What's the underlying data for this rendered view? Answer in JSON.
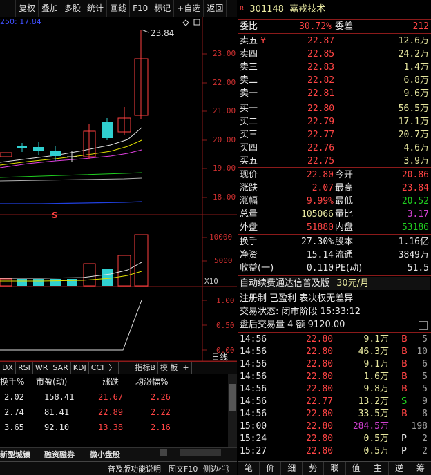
{
  "toolbar": {
    "items": [
      "复权",
      "叠加",
      "多股",
      "统计",
      "画线",
      "F10",
      "标记",
      "+自选",
      "返回"
    ]
  },
  "chart": {
    "ma_label": "250: 17.84",
    "high_marker": "23.84",
    "price_axis": [
      "23.00",
      "22.00",
      "21.00",
      "20.00",
      "19.00",
      "18.00"
    ],
    "s_marker": "S",
    "vol_axis": [
      "10000",
      "5000"
    ],
    "vol_unit": "X10",
    "ind_axis": [
      "1.00",
      "0.50",
      "0.00"
    ],
    "period_label": "日线"
  },
  "indicator_tabs": [
    "DX",
    "RSI",
    "WR",
    "SAR",
    "KDJ",
    "CCI",
    "〉",
    "指标B",
    "模 板",
    "+"
  ],
  "table": {
    "headers": [
      "换手%",
      "市盈(动)",
      "涨跌",
      "均涨幅%"
    ],
    "rows": [
      [
        "2.02",
        "158.41",
        "21.67",
        "2.26"
      ],
      [
        "2.74",
        "81.41",
        "22.89",
        "2.22"
      ],
      [
        "3.65",
        "92.10",
        "13.38",
        "2.16"
      ]
    ]
  },
  "bottom_tabs": [
    "新型城镇",
    "融资融券",
    "微小盘股"
  ],
  "statusbar": [
    "普及版功能说明",
    "图文F10",
    "侧边栏》"
  ],
  "quote": {
    "code": "301148",
    "name": "嘉戎技术",
    "tag": "R",
    "weibi_label": "委比",
    "weibi": "30.72%",
    "weicha_label": "委差",
    "weicha": "212",
    "sells": [
      {
        "label": "卖五",
        "mark": "¥",
        "price": "22.87",
        "vol": "12.6万"
      },
      {
        "label": "卖四",
        "mark": "",
        "price": "22.85",
        "vol": "24.2万"
      },
      {
        "label": "卖三",
        "mark": "",
        "price": "22.83",
        "vol": "1.4万"
      },
      {
        "label": "卖二",
        "mark": "",
        "price": "22.82",
        "vol": "6.8万"
      },
      {
        "label": "卖一",
        "mark": "",
        "price": "22.81",
        "vol": "9.6万"
      }
    ],
    "buys": [
      {
        "label": "买一",
        "price": "22.80",
        "vol": "56.5万"
      },
      {
        "label": "买二",
        "price": "22.79",
        "vol": "17.1万"
      },
      {
        "label": "买三",
        "price": "22.77",
        "vol": "20.7万"
      },
      {
        "label": "买四",
        "price": "22.76",
        "vol": "4.6万"
      },
      {
        "label": "买五",
        "price": "22.75",
        "vol": "3.9万"
      }
    ],
    "stats": [
      {
        "l1": "现价",
        "v1": "22.80",
        "c1": "red",
        "l2": "今开",
        "v2": "20.86",
        "c2": "red"
      },
      {
        "l1": "涨跌",
        "v1": "2.07",
        "c1": "red",
        "l2": "最高",
        "v2": "23.84",
        "c2": "red"
      },
      {
        "l1": "涨幅",
        "v1": "9.99%",
        "c1": "red",
        "l2": "最低",
        "v2": "20.52",
        "c2": "green"
      },
      {
        "l1": "总量",
        "v1": "105066",
        "c1": "yellow",
        "l2": "量比",
        "v2": "3.17",
        "c2": "magenta"
      },
      {
        "l1": "外盘",
        "v1": "51880",
        "c1": "red",
        "l2": "内盘",
        "v2": "53186",
        "c2": "green"
      }
    ],
    "fin": [
      {
        "l1": "换手",
        "v1": "27.30%",
        "l2": "股本",
        "v2": "1.16亿"
      },
      {
        "l1": "净资",
        "v1": "15.14",
        "l2": "流通",
        "v2": "3849万"
      },
      {
        "l1": "收益(一)",
        "v1": "0.110",
        "l2": "PE(动)",
        "v2": "51.5"
      }
    ],
    "ad_line": "自动续费通达信普及版",
    "ad_price": "30元/月",
    "info_line": "注册制 已盈利 表决权无差异",
    "status_label": "交易状态:",
    "status_value": "闭市阶段 15:33:12",
    "after_label": "盘后交易量 4 额 9120.00"
  },
  "ticks": [
    {
      "time": "14:56",
      "price": "22.80",
      "pc": "red",
      "vol": "9.1万",
      "vc": "yellow",
      "bs": "B",
      "bc": "red",
      "n": "5"
    },
    {
      "time": "14:56",
      "price": "22.80",
      "pc": "red",
      "vol": "46.3万",
      "vc": "yellow",
      "bs": "B",
      "bc": "red",
      "n": "10"
    },
    {
      "time": "14:56",
      "price": "22.80",
      "pc": "red",
      "vol": "9.1万",
      "vc": "yellow",
      "bs": "B",
      "bc": "red",
      "n": "6"
    },
    {
      "time": "14:56",
      "price": "22.80",
      "pc": "red",
      "vol": "1.6万",
      "vc": "yellow",
      "bs": "B",
      "bc": "red",
      "n": "5"
    },
    {
      "time": "14:56",
      "price": "22.80",
      "pc": "red",
      "vol": "9.8万",
      "vc": "yellow",
      "bs": "B",
      "bc": "red",
      "n": "5"
    },
    {
      "time": "14:56",
      "price": "22.77",
      "pc": "red",
      "vol": "13.2万",
      "vc": "yellow",
      "bs": "S",
      "bc": "green",
      "n": "9"
    },
    {
      "time": "14:56",
      "price": "22.80",
      "pc": "red",
      "vol": "33.5万",
      "vc": "yellow",
      "bs": "B",
      "bc": "red",
      "n": "8"
    },
    {
      "time": "15:00",
      "price": "22.80",
      "pc": "red",
      "vol": "284.5万",
      "vc": "magenta",
      "bs": "",
      "bc": "red",
      "n": "198"
    },
    {
      "time": "15:24",
      "price": "22.80",
      "pc": "red",
      "vol": "0.5万",
      "vc": "yellow",
      "bs": "P",
      "bc": "white",
      "n": "2"
    },
    {
      "time": "15:27",
      "price": "22.80",
      "pc": "red",
      "vol": "0.5万",
      "vc": "yellow",
      "bs": "P",
      "bc": "white",
      "n": "2"
    }
  ],
  "right_tabs": [
    "笔",
    "价",
    "细",
    "势",
    "联",
    "值",
    "主",
    "逆",
    "筹"
  ]
}
